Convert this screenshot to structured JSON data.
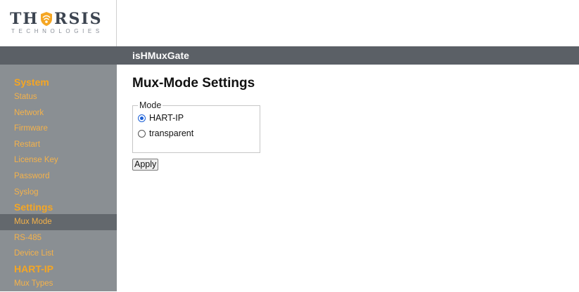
{
  "logo": {
    "title": "THORSIS",
    "title_part1": "TH",
    "title_part2": "RSIS",
    "subtitle": "TECHNOLOGIES",
    "icon": "shield-o-icon",
    "colors": {
      "text": "#3c4450",
      "accent": "#f5a623"
    }
  },
  "header": {
    "title": "isHMuxGate"
  },
  "sidebar": {
    "sections": [
      {
        "label": "System",
        "items": [
          {
            "label": "Status",
            "active": false
          },
          {
            "label": "Network",
            "active": false
          },
          {
            "label": "Firmware",
            "active": false
          },
          {
            "label": "Restart",
            "active": false
          },
          {
            "label": "License Key",
            "active": false
          },
          {
            "label": "Password",
            "active": false
          },
          {
            "label": "Syslog",
            "active": false
          }
        ]
      },
      {
        "label": "Settings",
        "items": [
          {
            "label": "Mux Mode",
            "active": true
          },
          {
            "label": "RS-485",
            "active": false
          },
          {
            "label": "Device List",
            "active": false
          }
        ]
      },
      {
        "label": "HART-IP",
        "items": [
          {
            "label": "Mux Types",
            "active": false
          }
        ]
      }
    ]
  },
  "main": {
    "title": "Mux-Mode Settings",
    "mode_group": {
      "legend": "Mode",
      "options": [
        {
          "label": "HART-IP",
          "checked": true
        },
        {
          "label": "transparent",
          "checked": false
        }
      ]
    },
    "apply_label": "Apply"
  },
  "colors": {
    "sidebar_bg": "#8a8f93",
    "header_bar": "#5b6066",
    "nav_section": "#f5a623",
    "nav_item": "#f5b24a",
    "nav_active_bg": "#63686d",
    "radio_checked": "#1a5fd6"
  }
}
